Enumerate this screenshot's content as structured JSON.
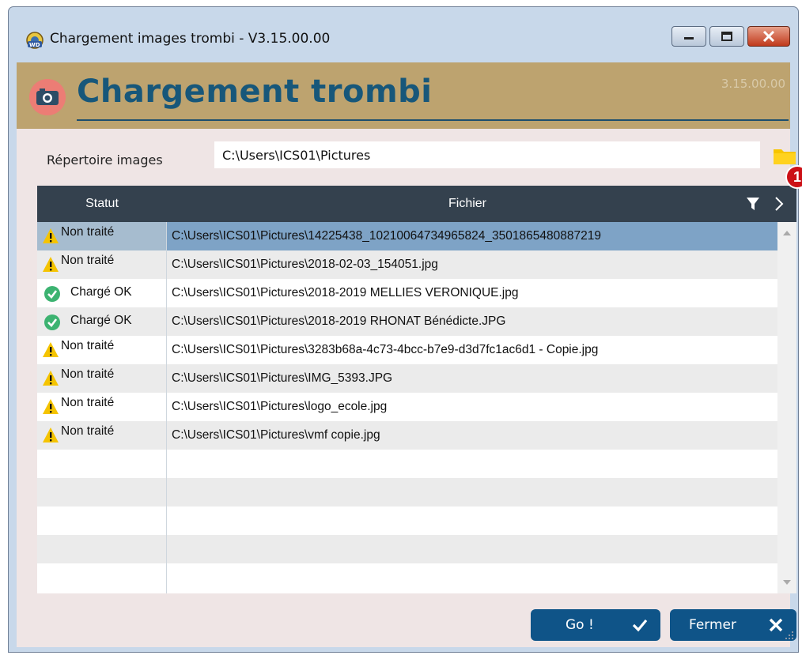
{
  "window": {
    "title": "Chargement images trombi - V3.15.00.00"
  },
  "banner": {
    "title": "Chargement trombi",
    "version": "3.15.00.00",
    "badge": "1"
  },
  "directory": {
    "label": "Répertoire images",
    "value": "C:\\Users\\ICS01\\Pictures"
  },
  "grid": {
    "columns": [
      "Statut",
      "Fichier"
    ],
    "rows": [
      {
        "status": "Non traité",
        "status_icon": "warning-icon",
        "file": "C:\\Users\\ICS01\\Pictures\\14225438_10210064734965824_3501865480887219",
        "selected": true
      },
      {
        "status": "Non traité",
        "status_icon": "warning-icon",
        "file": "C:\\Users\\ICS01\\Pictures\\2018-02-03_154051.jpg"
      },
      {
        "status": "Chargé OK",
        "status_icon": "check-circle-icon",
        "file": "C:\\Users\\ICS01\\Pictures\\2018-2019 MELLIES VERONIQUE.jpg"
      },
      {
        "status": "Chargé OK",
        "status_icon": "check-circle-icon",
        "file": "C:\\Users\\ICS01\\Pictures\\2018-2019 RHONAT Bénédicte.JPG"
      },
      {
        "status": "Non traité",
        "status_icon": "warning-icon",
        "file": "C:\\Users\\ICS01\\Pictures\\3283b68a-4c73-4bcc-b7e9-d3d7fc1ac6d1 - Copie.jpg"
      },
      {
        "status": "Non traité",
        "status_icon": "warning-icon",
        "file": "C:\\Users\\ICS01\\Pictures\\IMG_5393.JPG"
      },
      {
        "status": "Non traité",
        "status_icon": "warning-icon",
        "file": "C:\\Users\\ICS01\\Pictures\\logo_ecole.jpg"
      },
      {
        "status": "Non traité",
        "status_icon": "warning-icon",
        "file": "C:\\Users\\ICS01\\Pictures\\vmf copie.jpg"
      }
    ]
  },
  "buttons": {
    "go": "Go !",
    "close": "Fermer"
  },
  "colors": {
    "banner": "#bda36f",
    "title": "#17577a",
    "header": "#34414e",
    "selected_row": "#7ea3c6",
    "button": "#0f5488",
    "ok_green": "#3cb371",
    "warning_yellow": "#f5c400"
  }
}
